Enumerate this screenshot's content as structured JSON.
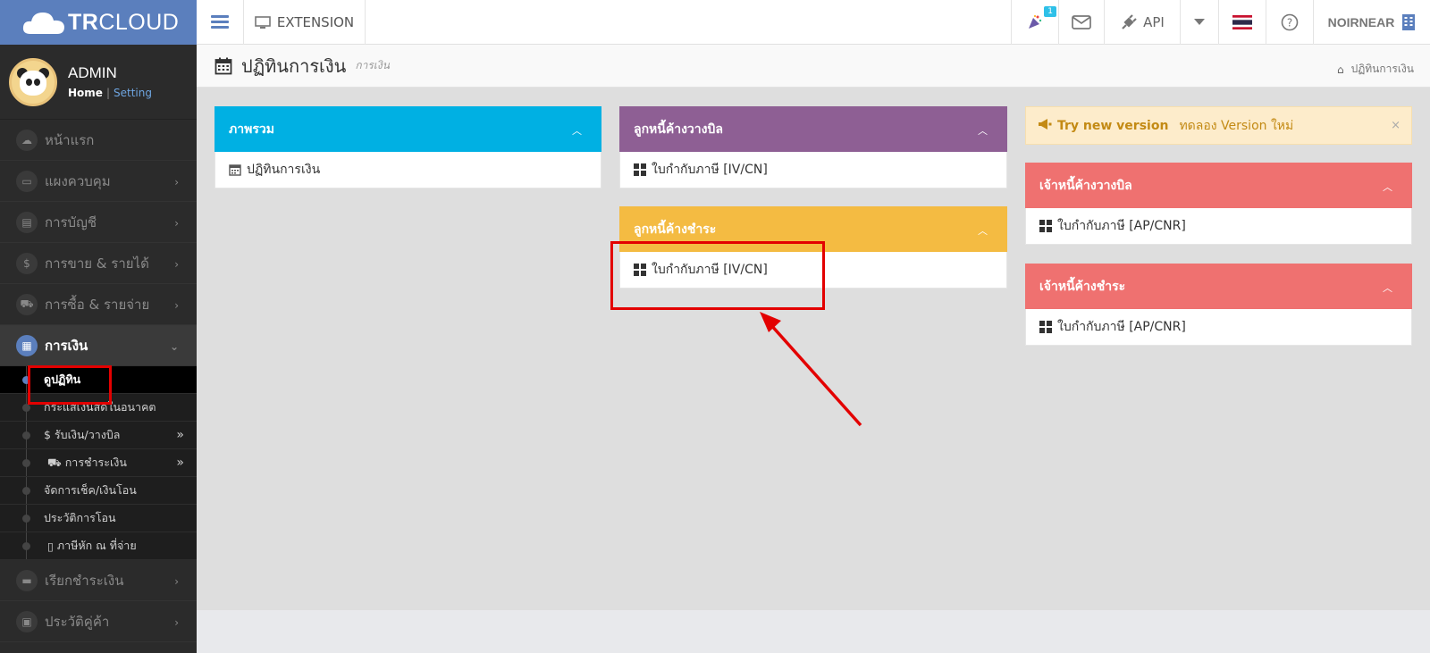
{
  "brand": {
    "bold": "TR",
    "rest": "CLOUD"
  },
  "topbar": {
    "extension_label": "EXTENSION",
    "notification_badge": "1",
    "api_label": "API",
    "user_label": "NOIRNEAR"
  },
  "profile": {
    "name": "ADMIN",
    "home_link": "Home",
    "setting_link": "Setting"
  },
  "sidebar": {
    "items": [
      {
        "label": "หน้าแรก",
        "icon": "cloud-icon"
      },
      {
        "label": "แผงควบคุม",
        "icon": "monitor-icon"
      },
      {
        "label": "การบัญชี",
        "icon": "book-icon"
      },
      {
        "label": "การขาย & รายได้",
        "icon": "dollar-icon"
      },
      {
        "label": "การซื้อ & รายจ่าย",
        "icon": "cart-icon"
      }
    ],
    "active": {
      "label": "การเงิน",
      "icon": "calendar-icon"
    },
    "submenu": [
      {
        "label": "ดูปฏิทิน"
      },
      {
        "label": "กระแสเงินสดในอนาคต"
      },
      {
        "label": "$ รับเงิน/วางบิล"
      },
      {
        "label": "การชำระเงิน"
      },
      {
        "label": "จัดการเช็ค/เงินโอน"
      },
      {
        "label": "ประวัติการโอน"
      },
      {
        "label": "ภาษีหัก ณ ที่จ่าย"
      }
    ],
    "bottom_items": [
      {
        "label": "เรียกชำระเงิน",
        "icon": "card-icon"
      },
      {
        "label": "ประวัติคู่ค้า",
        "icon": "contact-icon"
      }
    ]
  },
  "page": {
    "title": "ปฏิทินการเงิน",
    "subtitle": "การเงิน",
    "breadcrumb": "ปฏิทินการเงิน"
  },
  "panels": {
    "overview": {
      "title": "ภาพรวม",
      "item": "ปฏิทินการเงิน"
    },
    "ar_billing": {
      "title": "ลูกหนี้ค้างวางบิล",
      "item": "ใบกำกับภาษี [IV/CN]"
    },
    "ar_payment": {
      "title": "ลูกหนี้ค้างชำระ",
      "item": "ใบกำกับภาษี [IV/CN]"
    },
    "ap_billing": {
      "title": "เจ้าหนี้ค้างวางบิล",
      "item": "ใบกำกับภาษี [AP/CNR]"
    },
    "ap_payment": {
      "title": "เจ้าหนี้ค้างชำระ",
      "item": "ใบกำกับภาษี [AP/CNR]"
    }
  },
  "alert": {
    "strong": "Try new version",
    "text": "ทดลอง Version ใหม่",
    "close": "×"
  },
  "colors": {
    "brand": "#5b7fbd",
    "blue": "#00b0e3",
    "purple": "#8e5f94",
    "yellow": "#f4bb42",
    "red": "#ef7170",
    "highlight": "#e30000"
  }
}
